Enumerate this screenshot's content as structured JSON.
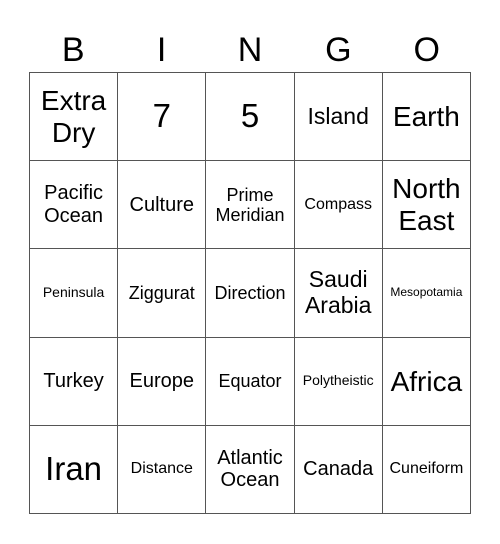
{
  "header": {
    "letters": [
      "B",
      "I",
      "N",
      "G",
      "O"
    ]
  },
  "grid": {
    "rows": [
      [
        "Extra Dry",
        "7",
        "5",
        "Island",
        "Earth"
      ],
      [
        "Pacific Ocean",
        "Culture",
        "Prime Meridian",
        "Compass",
        "North East"
      ],
      [
        "Peninsula",
        "Ziggurat",
        "Direction",
        "Saudi Arabia",
        "Mesopotamia"
      ],
      [
        "Turkey",
        "Europe",
        "Equator",
        "Polytheistic",
        "Africa"
      ],
      [
        "Iran",
        "Distance",
        "Atlantic Ocean",
        "Canada",
        "Cuneiform"
      ]
    ]
  }
}
